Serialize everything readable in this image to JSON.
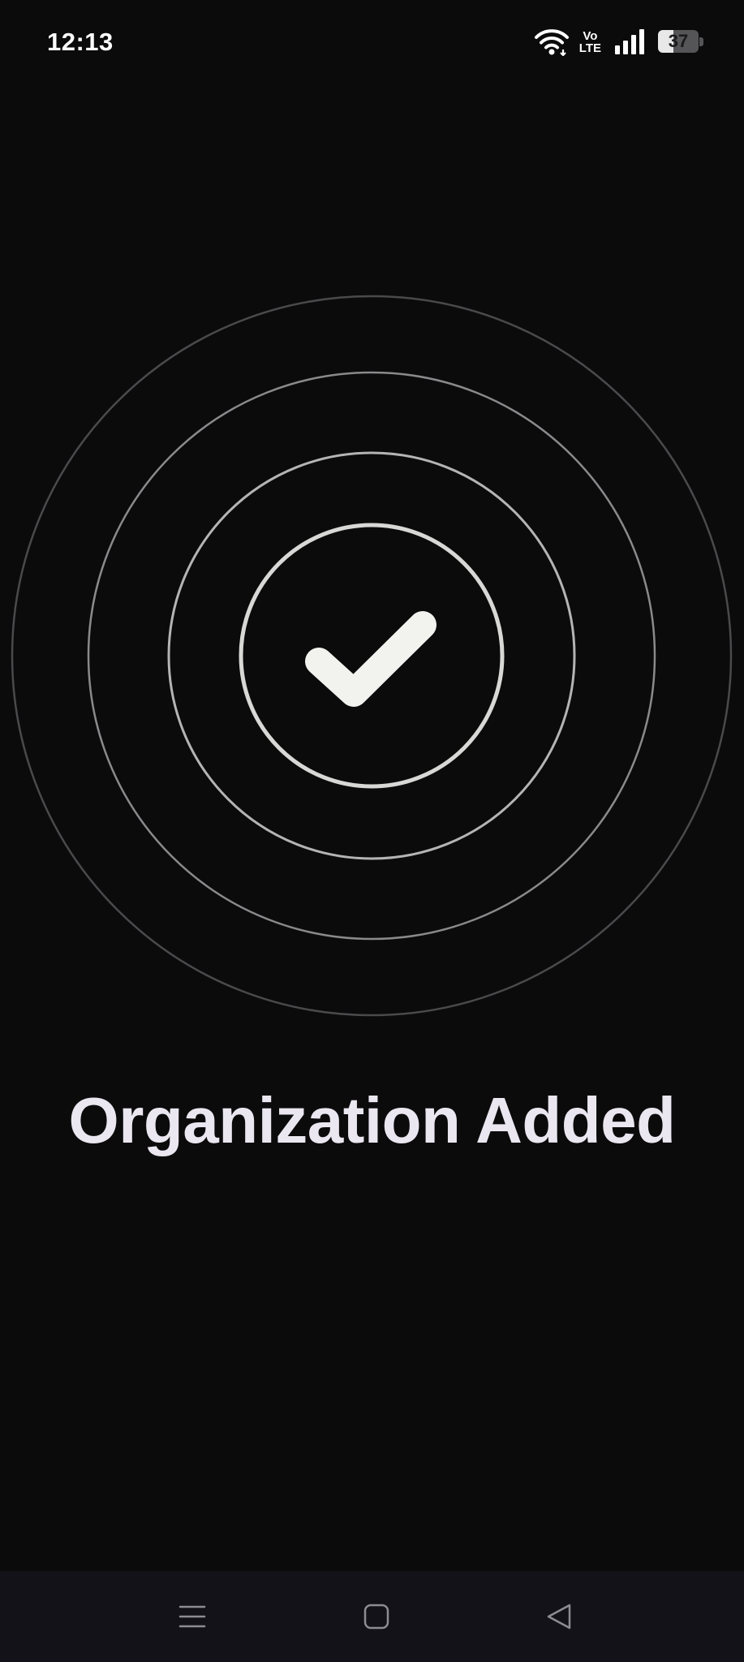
{
  "status_bar": {
    "time": "12:13",
    "volte_top": "Vo",
    "volte_bottom": "LTE",
    "battery_level": 37,
    "battery_text": "37",
    "icons": [
      "wifi-icon",
      "volte-icon",
      "signal-icon",
      "battery-icon"
    ]
  },
  "success": {
    "icon": "checkmark-icon",
    "title": "Organization Added"
  },
  "nav_bar": {
    "buttons": [
      "menu-icon",
      "home-icon",
      "back-icon"
    ]
  },
  "colors": {
    "background": "#0b0b0c",
    "title": "#ebe7f0",
    "checkmark": "#f2f2ef",
    "nav_bar": "#121218"
  }
}
